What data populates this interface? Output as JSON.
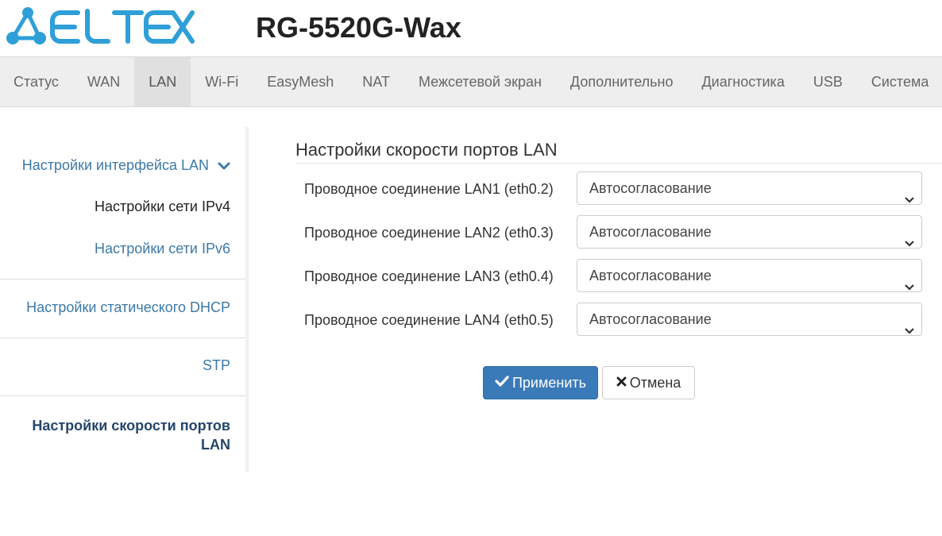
{
  "header": {
    "logo_text": "ELTEX",
    "device_title": "RG-5520G-Wax"
  },
  "nav": {
    "items": [
      {
        "label": "Статус"
      },
      {
        "label": "WAN"
      },
      {
        "label": "LAN",
        "active": true
      },
      {
        "label": "Wi-Fi"
      },
      {
        "label": "EasyMesh"
      },
      {
        "label": "NAT"
      },
      {
        "label": "Межсетевой экран"
      },
      {
        "label": "Дополнительно"
      },
      {
        "label": "Диагностика"
      },
      {
        "label": "USB"
      },
      {
        "label": "Система"
      }
    ]
  },
  "sidebar": {
    "lan_interface": "Настройки интерфейса LAN",
    "ipv4": "Настройки сети IPv4",
    "ipv6": "Настройки сети IPv6",
    "static_dhcp": "Настройки статического DHCP",
    "stp": "STP",
    "port_speed_line1": "Настройки скорости портов",
    "port_speed_line2": "LAN"
  },
  "main": {
    "title": "Настройки скорости портов LAN",
    "rows": [
      {
        "label": "Проводное соединение LAN1 (eth0.2)",
        "value": "Автосогласование"
      },
      {
        "label": "Проводное соединение LAN2 (eth0.3)",
        "value": "Автосогласование"
      },
      {
        "label": "Проводное соединение LAN3 (eth0.4)",
        "value": "Автосогласование"
      },
      {
        "label": "Проводное соединение LAN4 (eth0.5)",
        "value": "Автосогласование"
      }
    ],
    "apply_label": "Применить",
    "cancel_label": "Отмена"
  },
  "colors": {
    "brand": "#2f9fd8",
    "link": "#3d79a7",
    "primary_button": "#3a7ab8",
    "nav_bg": "#eeeeee"
  },
  "icons": {
    "logo": "eltex-logo-icon",
    "sidebar_expand": "chevron-down-icon",
    "select_caret": "chevron-down-icon",
    "apply": "check-icon",
    "cancel": "close-icon"
  }
}
